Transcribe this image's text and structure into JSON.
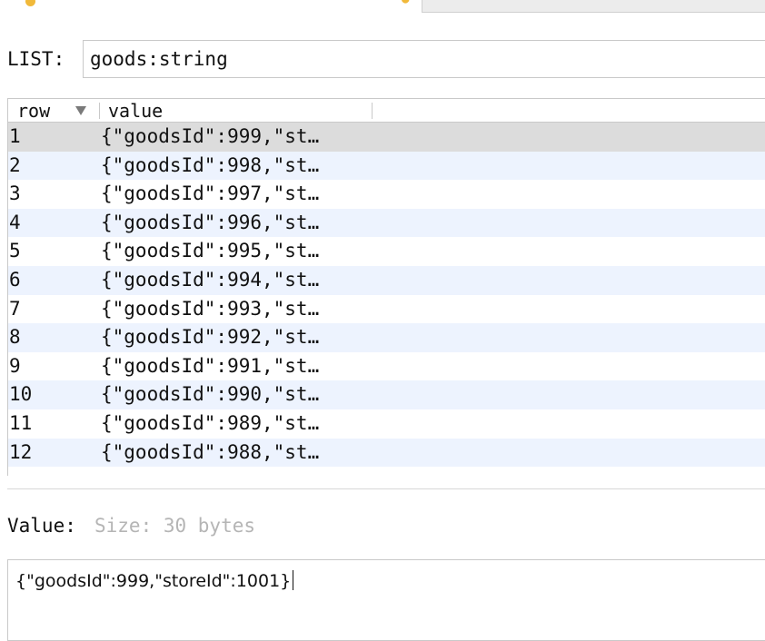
{
  "list": {
    "label": "LIST:",
    "value": "goods:string"
  },
  "table": {
    "columns": {
      "row": "row",
      "value": "value"
    },
    "rows": [
      {
        "row": "1",
        "value": "{\"goodsId\":999,\"st…"
      },
      {
        "row": "2",
        "value": "{\"goodsId\":998,\"st…"
      },
      {
        "row": "3",
        "value": "{\"goodsId\":997,\"st…"
      },
      {
        "row": "4",
        "value": "{\"goodsId\":996,\"st…"
      },
      {
        "row": "5",
        "value": "{\"goodsId\":995,\"st…"
      },
      {
        "row": "6",
        "value": "{\"goodsId\":994,\"st…"
      },
      {
        "row": "7",
        "value": "{\"goodsId\":993,\"st…"
      },
      {
        "row": "8",
        "value": "{\"goodsId\":992,\"st…"
      },
      {
        "row": "9",
        "value": "{\"goodsId\":991,\"st…"
      },
      {
        "row": "10",
        "value": "{\"goodsId\":990,\"st…"
      },
      {
        "row": "11",
        "value": "{\"goodsId\":989,\"st…"
      },
      {
        "row": "12",
        "value": "{\"goodsId\":988,\"st…"
      }
    ]
  },
  "value_panel": {
    "label": "Value:",
    "size_text": "Size: 30 bytes",
    "content": "{\"goodsId\":999,\"storeId\":1001}"
  },
  "icons": {
    "tab_key": "key-icon",
    "tab_modified": "modified-icon",
    "sort": "sort-descending-icon"
  },
  "colors": {
    "accent_orange": "#f1b93a",
    "row_alt": "#edf3fe",
    "row_selected": "#dcdcdc",
    "placeholder_gray": "#b5b5b5"
  }
}
